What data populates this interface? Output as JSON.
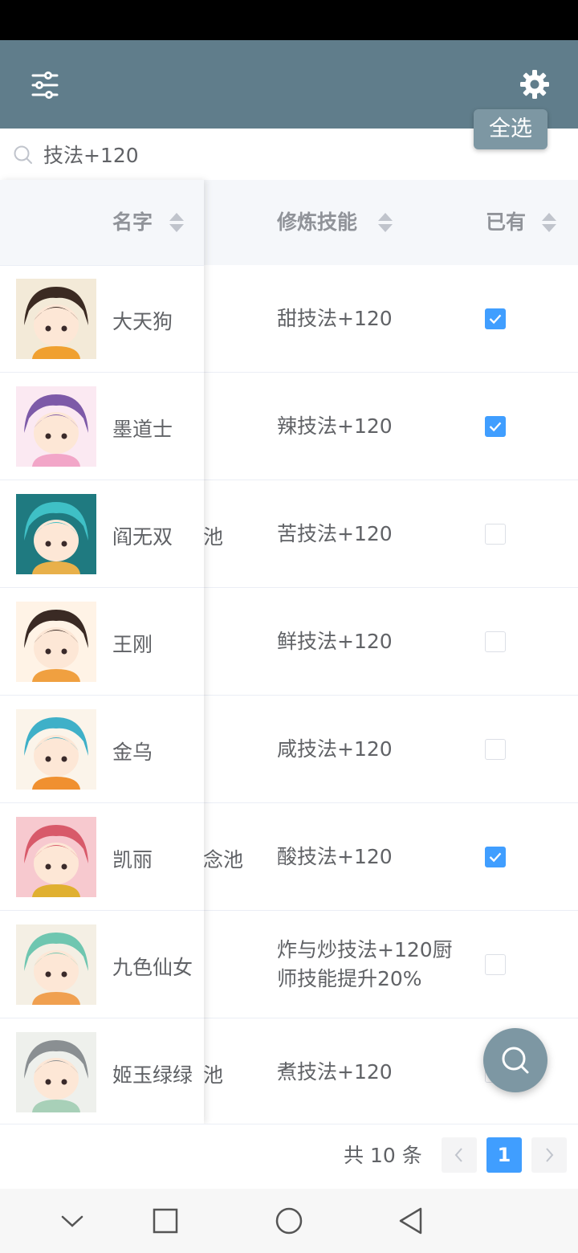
{
  "header": {
    "select_all_label": "全选"
  },
  "search": {
    "value": "技法+120"
  },
  "table": {
    "columns": {
      "name": "名字",
      "skill": "修炼技能",
      "owned": "已有"
    },
    "rows": [
      {
        "name": "大天狗",
        "pool": "",
        "skill": "甜技法+120",
        "owned": true,
        "palette": [
          "#f3ead8",
          "#3b2a22",
          "#f0a030"
        ]
      },
      {
        "name": "墨道士",
        "pool": "",
        "skill": "辣技法+120",
        "owned": true,
        "palette": [
          "#fbe9f2",
          "#7d5aa8",
          "#f2a6c8"
        ]
      },
      {
        "name": "阎无双",
        "pool": "池",
        "skill": "苦技法+120",
        "owned": false,
        "palette": [
          "#1f7a80",
          "#3fc0c6",
          "#e8b04a"
        ]
      },
      {
        "name": "王刚",
        "pool": "",
        "skill": "鲜技法+120",
        "owned": false,
        "palette": [
          "#fff3e6",
          "#3a2a24",
          "#f0a040"
        ]
      },
      {
        "name": "金乌",
        "pool": "",
        "skill": "咸技法+120",
        "owned": false,
        "palette": [
          "#fbf4ea",
          "#3fb0c8",
          "#f09030"
        ]
      },
      {
        "name": "凯丽",
        "pool": "念池",
        "skill": "酸技法+120",
        "owned": true,
        "palette": [
          "#f7c9cf",
          "#d85a6a",
          "#e0b030"
        ]
      },
      {
        "name": "九色仙女",
        "pool": "",
        "skill": "炸与炒技法+120厨师技能提升20%",
        "owned": false,
        "palette": [
          "#f4efe4",
          "#6fc6b0",
          "#f0a050"
        ]
      },
      {
        "name": "姬玉绿绿",
        "pool": "池",
        "skill": "煮技法+120",
        "owned": false,
        "palette": [
          "#eef0ec",
          "#8a8f92",
          "#a8d0b8"
        ]
      }
    ]
  },
  "pagination": {
    "total": "共 10 条",
    "current": "1"
  },
  "colors": {
    "header_bg": "#607d8b",
    "accent": "#409eff",
    "select_all_bg": "#7d97a3"
  },
  "icons": {
    "filter": "sliders-icon",
    "settings": "gear-icon",
    "search": "search-icon",
    "float": "search-icon",
    "nav": [
      "chevron-down-icon",
      "square-icon",
      "circle-icon",
      "triangle-back-icon"
    ]
  }
}
